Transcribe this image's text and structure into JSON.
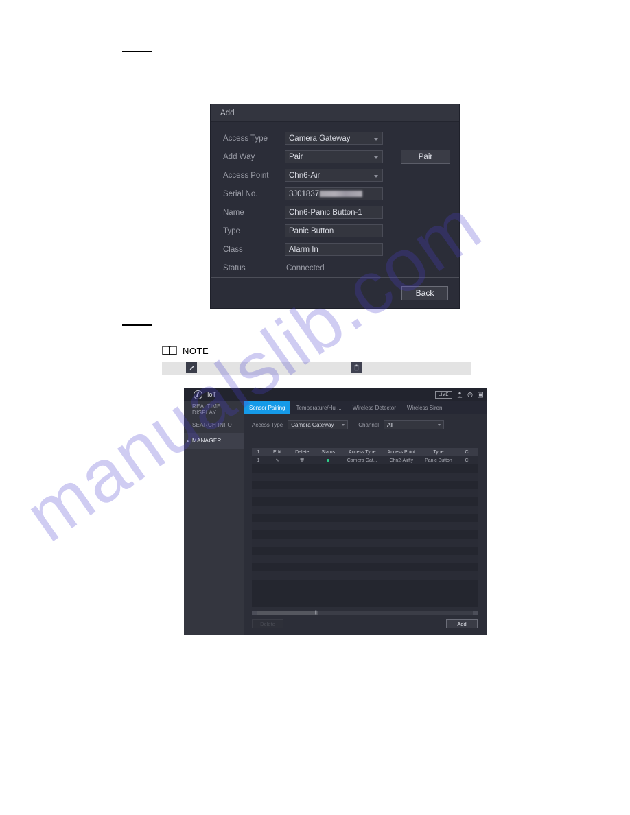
{
  "page": {
    "background": "#ffffff",
    "watermark_text": "manualslib.com",
    "watermark_color": "#4a3fd0"
  },
  "redactions": {
    "top_rule": "",
    "mid_rule": ""
  },
  "add_dialog": {
    "title": "Add",
    "rows": [
      {
        "label": "Access Type",
        "value": "Camera Gateway",
        "kind": "select"
      },
      {
        "label": "Add Way",
        "value": "Pair",
        "kind": "select",
        "button": "Pair"
      },
      {
        "label": "Access Point",
        "value": "Chn6-Air",
        "kind": "select"
      },
      {
        "label": "Serial No.",
        "value": "3J01837",
        "kind": "input-masked"
      },
      {
        "label": "Name",
        "value": "Chn6-Panic Button-1",
        "kind": "input"
      },
      {
        "label": "Type",
        "value": "Panic Button",
        "kind": "input"
      },
      {
        "label": "Class",
        "value": "Alarm In",
        "kind": "input"
      },
      {
        "label": "Status",
        "value": "Connected",
        "kind": "static"
      }
    ],
    "back_label": "Back"
  },
  "note": {
    "label": "NOTE",
    "icon": "book-icon",
    "bar_edit_icon": "pencil-icon",
    "bar_delete_icon": "trash-icon"
  },
  "iot": {
    "window_title": "IoT",
    "live_badge": "LIVE",
    "titlebar_icons": [
      "user-icon",
      "power-icon",
      "window-icon"
    ],
    "sidebar": [
      {
        "label": "REALTIME DISPLAY",
        "selected": false
      },
      {
        "label": "SEARCH INFO",
        "selected": false
      },
      {
        "label": "MANAGER",
        "selected": true
      }
    ],
    "tabs": [
      {
        "label": "Sensor Pairing",
        "active": true
      },
      {
        "label": "Temperature/Hu ...",
        "active": false
      },
      {
        "label": "Wireless Detector",
        "active": false
      },
      {
        "label": "Wireless Siren",
        "active": false
      }
    ],
    "filters": {
      "access_type_label": "Access Type",
      "access_type_value": "Camera Gateway",
      "channel_label": "Channel",
      "channel_value": "All"
    },
    "table": {
      "columns": [
        "1",
        "Edit",
        "Delete",
        "Status",
        "Access Type",
        "Access Point",
        "Type",
        "Cl"
      ],
      "rows": [
        {
          "index": "1",
          "edit_icon": "pencil-icon",
          "delete_icon": "trash-icon",
          "status": "online",
          "access_type": "Camera Gat...",
          "access_point": "Chn2-Airfly",
          "type": "Panic Button",
          "cls": "Cl"
        }
      ],
      "empty_row_count": 14,
      "status_dot_color": "#2ed08a"
    },
    "buttons": {
      "delete_label": "Delete",
      "add_label": "Add"
    },
    "accent_color": "#159ae8"
  }
}
